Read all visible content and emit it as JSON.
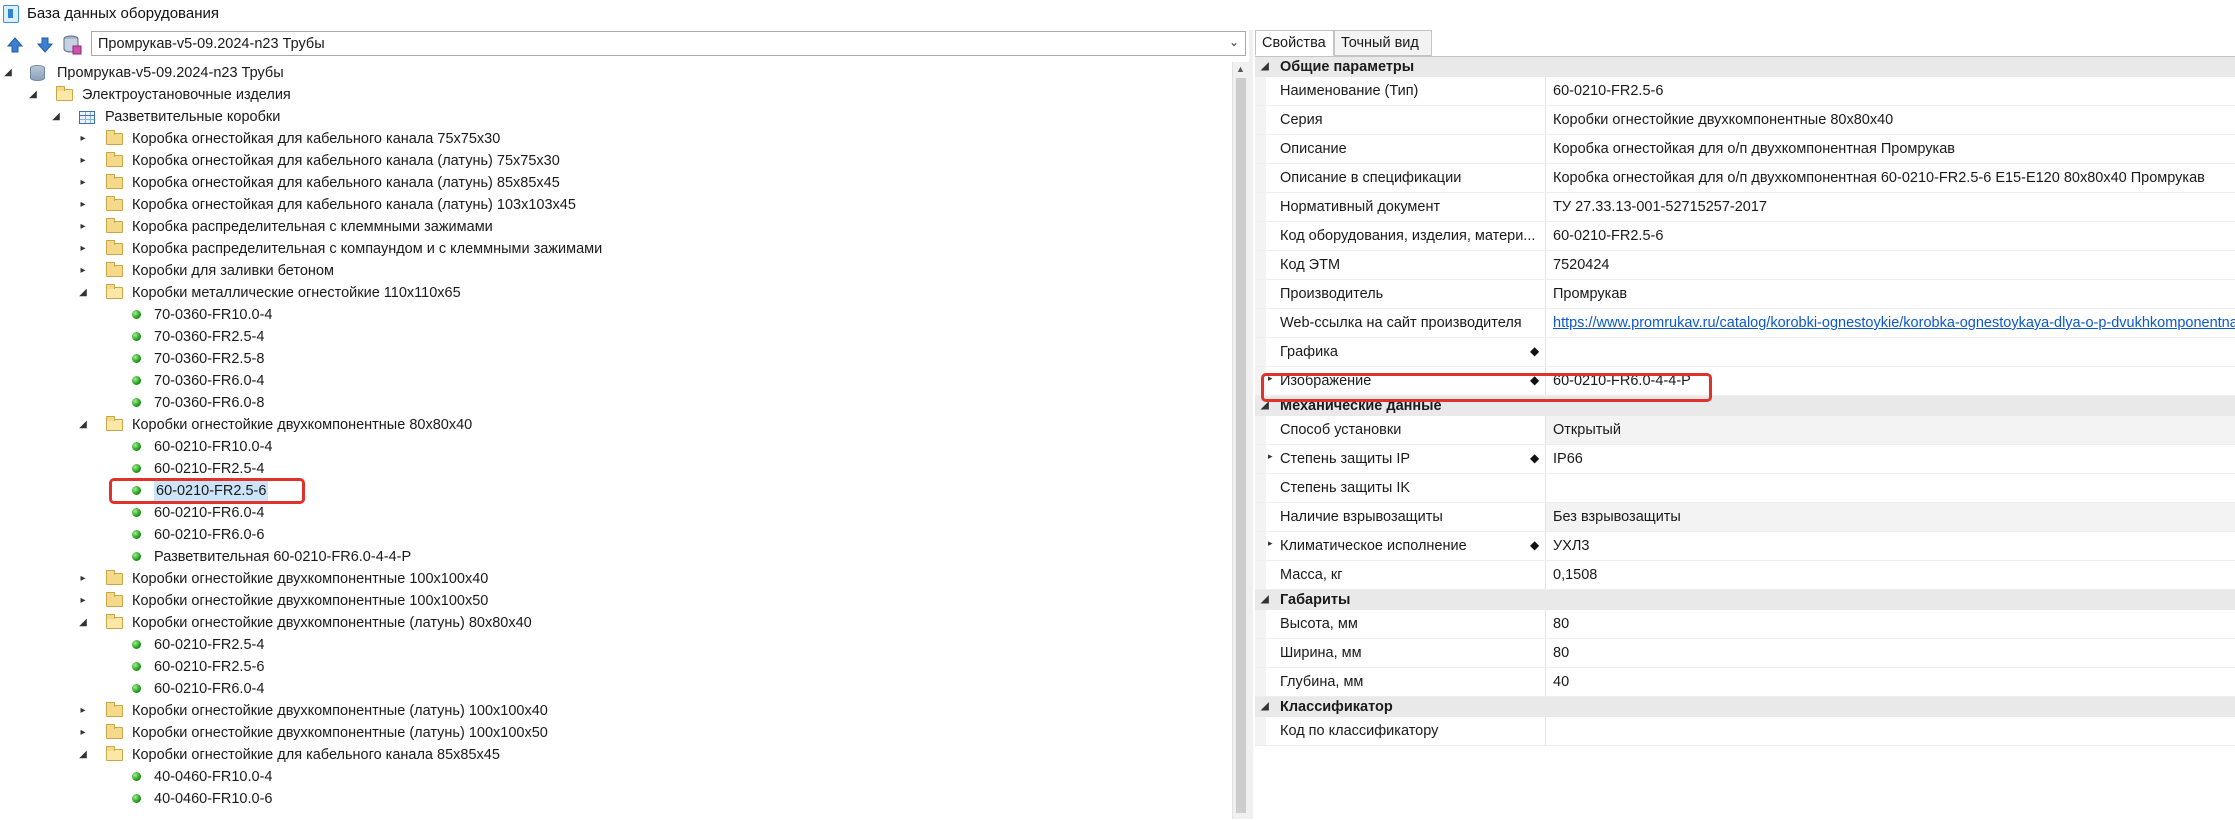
{
  "window": {
    "title": "База данных оборудования"
  },
  "toolbar": {
    "combo_value": "Промрукав-v5-09.2024-n23 Трубы",
    "buttons": [
      "arrow-up-icon",
      "arrow-down-icon",
      "database-icon"
    ]
  },
  "tree": {
    "root": "Промрукав-v5-09.2024-n23 Трубы",
    "l1": "Электроустановочные изделия",
    "l2": "Разветвительные коробки",
    "rows": [
      {
        "type": "folder",
        "label": "Коробка огнестойкая для кабельного канала 75x75x30"
      },
      {
        "type": "folder",
        "label": "Коробка огнестойкая для кабельного канала (латунь) 75x75x30"
      },
      {
        "type": "folder",
        "label": "Коробка огнестойкая для кабельного канала (латунь) 85x85x45"
      },
      {
        "type": "folder",
        "label": "Коробка огнестойкая для кабельного канала (латунь) 103x103x45"
      },
      {
        "type": "folder",
        "label": "Коробка распределительная с клеммными зажимами"
      },
      {
        "type": "folder",
        "label": "Коробка распределительная с компаундом и с клеммными зажимами"
      },
      {
        "type": "folder",
        "label": "Коробки для заливки бетоном"
      },
      {
        "type": "folder-open",
        "label": "Коробки металлические огнестойкие 110x110x65"
      },
      {
        "type": "item",
        "label": "70-0360-FR10.0-4"
      },
      {
        "type": "item",
        "label": "70-0360-FR2.5-4"
      },
      {
        "type": "item",
        "label": "70-0360-FR2.5-8"
      },
      {
        "type": "item",
        "label": "70-0360-FR6.0-4"
      },
      {
        "type": "item",
        "label": "70-0360-FR6.0-8"
      },
      {
        "type": "folder-open",
        "label": "Коробки огнестойкие двухкомпонентные 80x80x40"
      },
      {
        "type": "item",
        "label": "60-0210-FR10.0-4"
      },
      {
        "type": "item",
        "label": "60-0210-FR2.5-4"
      },
      {
        "type": "item-selected",
        "label": "60-0210-FR2.5-6"
      },
      {
        "type": "item",
        "label": "60-0210-FR6.0-4"
      },
      {
        "type": "item",
        "label": "60-0210-FR6.0-6"
      },
      {
        "type": "item",
        "label": "Разветвительная 60-0210-FR6.0-4-4-P"
      },
      {
        "type": "folder",
        "label": "Коробки огнестойкие двухкомпонентные 100x100x40"
      },
      {
        "type": "folder",
        "label": "Коробки огнестойкие двухкомпонентные 100x100x50"
      },
      {
        "type": "folder-open",
        "label": "Коробки огнестойкие двухкомпонентные (латунь) 80x80x40"
      },
      {
        "type": "item",
        "label": "60-0210-FR2.5-4"
      },
      {
        "type": "item",
        "label": "60-0210-FR2.5-6"
      },
      {
        "type": "item",
        "label": "60-0210-FR6.0-4"
      },
      {
        "type": "folder",
        "label": "Коробки огнестойкие двухкомпонентные (латунь) 100x100x40"
      },
      {
        "type": "folder",
        "label": "Коробки огнестойкие двухкомпонентные (латунь) 100x100x50"
      },
      {
        "type": "folder-open",
        "label": "Коробки огнестойкие для кабельного канала 85x85x45"
      },
      {
        "type": "item",
        "label": "40-0460-FR10.0-4"
      },
      {
        "type": "item",
        "label": "40-0460-FR10.0-6"
      }
    ]
  },
  "tabs": [
    "Свойства",
    "Точный вид"
  ],
  "properties": {
    "general": {
      "title": "Общие параметры",
      "rows": [
        {
          "name": "Наименование (Тип)",
          "value": "60-0210-FR2.5-6"
        },
        {
          "name": "Серия",
          "value": "Коробки огнестойкие двухкомпонентные 80x80x40"
        },
        {
          "name": "Описание",
          "value": "Коробка огнестойкая для о/п двухкомпонентная Промрукав"
        },
        {
          "name": "Описание в спецификации",
          "value": "Коробка огнестойкая для о/п двухкомпонентная 60-0210-FR2.5-6 E15-E120 80x80x40 Промрукав"
        },
        {
          "name": "Нормативный документ",
          "value": "ТУ 27.33.13-001-52715257-2017"
        },
        {
          "name": "Код оборудования, изделия, матери...",
          "value": "60-0210-FR2.5-6"
        },
        {
          "name": "Код ЭТМ",
          "value": "7520424"
        },
        {
          "name": "Производитель",
          "value": "Промрукав"
        },
        {
          "name": "Web-ссылка на сайт производителя",
          "value": "https://www.promrukav.ru/catalog/korobki-ognestoykie/korobka-ognestoykaya-dlya-o-p-dvukhkomponentnaya"
        },
        {
          "name": "Графика",
          "value": ""
        },
        {
          "name": "Изображение",
          "value": "60-0210-FR6.0-4-4-P"
        }
      ]
    },
    "mechanical": {
      "title": "Механические данные",
      "rows": [
        {
          "name": "Способ установки",
          "value": "Открытый"
        },
        {
          "name": "Степень защиты IP",
          "value": "IP66"
        },
        {
          "name": "Степень защиты IK",
          "value": ""
        },
        {
          "name": "Наличие взрывозащиты",
          "value": "Без взрывозащиты"
        },
        {
          "name": "Климатическое исполнение",
          "value": "УХЛ3"
        },
        {
          "name": "Масса, кг",
          "value": "0,1508"
        }
      ]
    },
    "dimensions": {
      "title": "Габариты",
      "rows": [
        {
          "name": "Высота, мм",
          "value": "80"
        },
        {
          "name": "Ширина, мм",
          "value": "80"
        },
        {
          "name": "Глубина, мм",
          "value": "40"
        }
      ]
    },
    "classifier": {
      "title": "Классификатор",
      "rows": [
        {
          "name": "Код по классификатору",
          "value": ""
        }
      ]
    }
  },
  "colors": {
    "highlight_box": "#e0322a",
    "link": "#0b57d0",
    "selection": "#cce4f7"
  }
}
